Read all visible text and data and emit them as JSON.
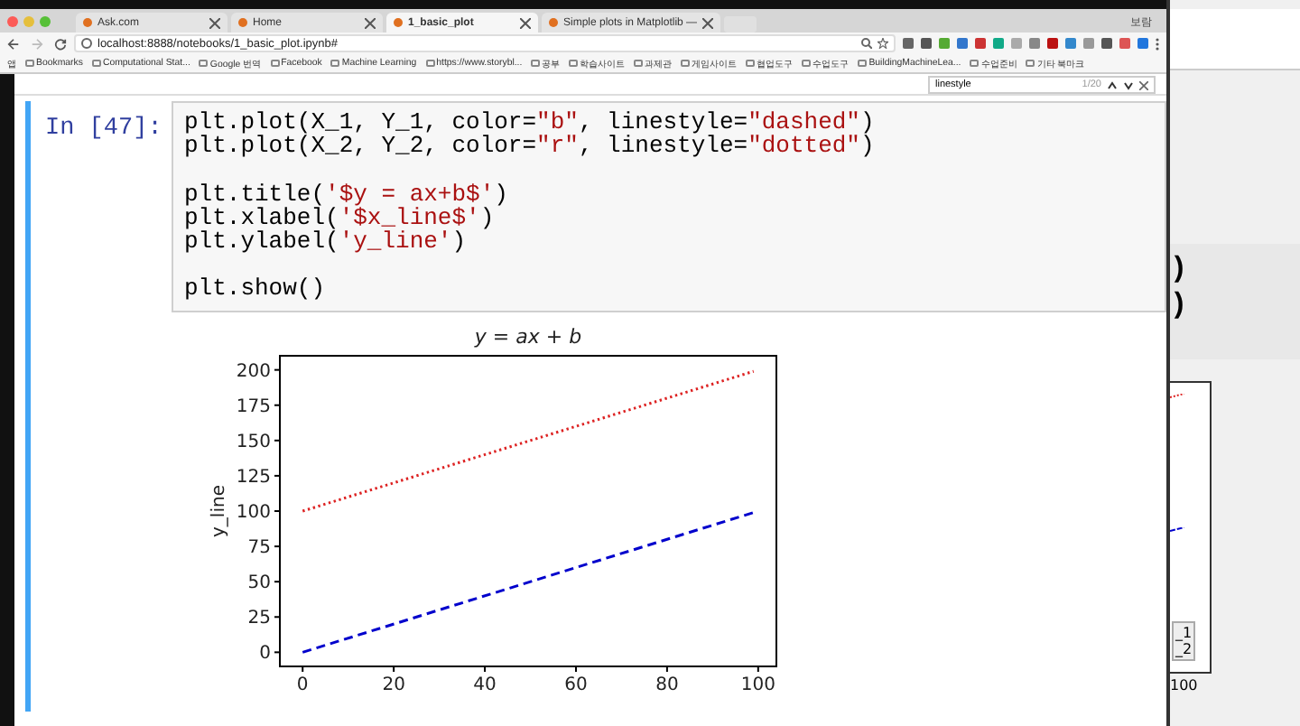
{
  "browser": {
    "tabs": [
      {
        "title": "Ask.com",
        "selected": false
      },
      {
        "title": "Home",
        "selected": false
      },
      {
        "title": "1_basic_plot",
        "selected": true
      },
      {
        "title": "Simple plots in Matplotlib —",
        "selected": false
      }
    ],
    "profile": "보람",
    "address": "localhost:8888/notebooks/1_basic_plot.ipynb#",
    "bookmarks": [
      "앱",
      "Bookmarks",
      "Computational Stat...",
      "Google 번역",
      "Facebook",
      "Machine Learning",
      "https://www.storybl...",
      "공부",
      "학습사이트",
      "과제관",
      "게임사이트",
      "협업도구",
      "수업도구",
      "BuildingMachineLea...",
      "수업준비",
      "기타 북마크"
    ],
    "find": {
      "value": "linestyle",
      "count": "1/20"
    }
  },
  "cell": {
    "prompt": "In [47]:",
    "blocks": [
      [
        [
          {
            "kind": "code",
            "text": "plt.plot(X_1, Y_1, color="
          },
          {
            "kind": "string",
            "text": "\"b\""
          },
          {
            "kind": "code",
            "text": ", linestyle="
          },
          {
            "kind": "string",
            "text": "\"dashed\""
          },
          {
            "kind": "code",
            "text": ")"
          }
        ],
        [
          {
            "kind": "code",
            "text": "plt.plot(X_2, Y_2, color="
          },
          {
            "kind": "string",
            "text": "\"r\""
          },
          {
            "kind": "code",
            "text": ", linestyle="
          },
          {
            "kind": "string",
            "text": "\"dotted\""
          },
          {
            "kind": "code",
            "text": ")"
          }
        ]
      ],
      [
        [
          {
            "kind": "code",
            "text": "plt.title("
          },
          {
            "kind": "string",
            "text": "'$y = ax+b$'"
          },
          {
            "kind": "code",
            "text": ")"
          }
        ],
        [
          {
            "kind": "code",
            "text": "plt.xlabel("
          },
          {
            "kind": "string",
            "text": "'$x_line$'"
          },
          {
            "kind": "code",
            "text": ")"
          }
        ],
        [
          {
            "kind": "code",
            "text": "plt.ylabel("
          },
          {
            "kind": "string",
            "text": "'y_line'"
          },
          {
            "kind": "code",
            "text": ")"
          }
        ]
      ],
      [
        [
          {
            "kind": "code",
            "text": "plt.show()"
          }
        ]
      ]
    ],
    "output": {
      "chart_data": {
        "type": "line",
        "title": "y = ax + b",
        "ylabel": "y_line",
        "x": [
          0,
          99
        ],
        "series": [
          {
            "color": "#0000cc",
            "line_style": "dashed",
            "values": [
              0,
              99
            ]
          },
          {
            "color": "#dd2222",
            "line_style": "dotted",
            "values": [
              100,
              199
            ]
          }
        ],
        "xlim": [
          -5,
          104
        ],
        "ylim": [
          -10,
          210
        ],
        "xticks": [
          0,
          20,
          40,
          60,
          80,
          100
        ],
        "yticks": [
          0,
          25,
          50,
          75,
          100,
          125,
          150,
          175,
          200
        ]
      }
    }
  },
  "background_window": {
    "code_fragments": [
      ")",
      ")"
    ],
    "legend": [
      "_1",
      "_2"
    ],
    "tick": "100"
  }
}
